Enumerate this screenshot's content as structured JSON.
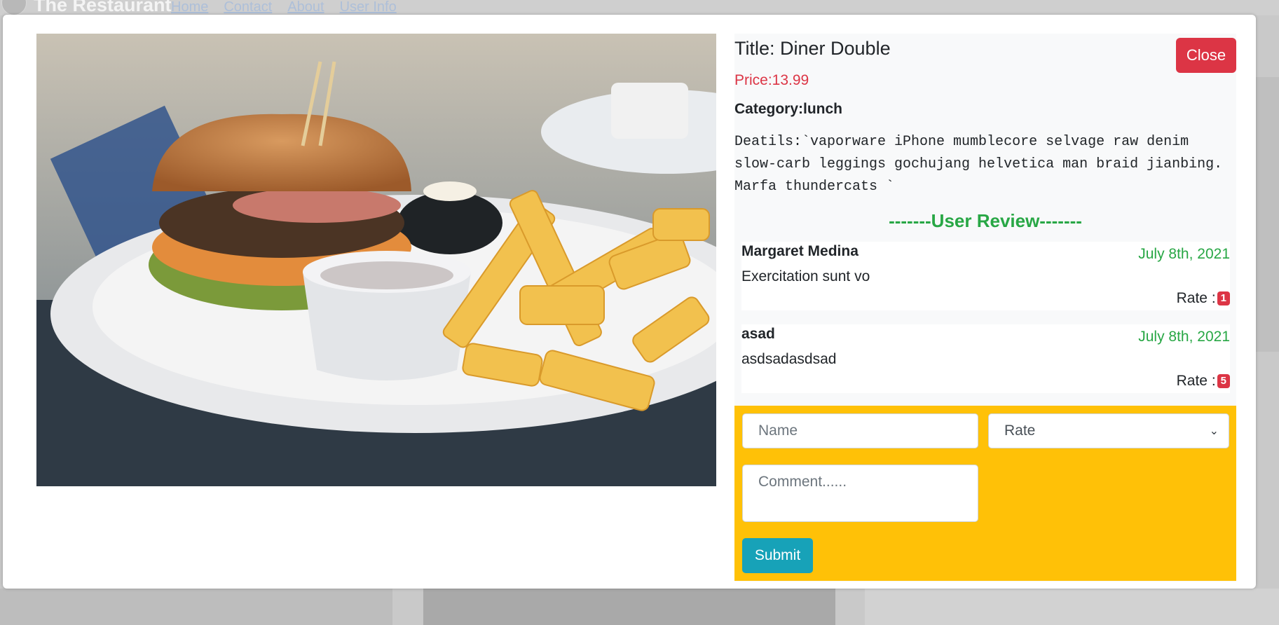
{
  "background": {
    "brand": "The Restaurant",
    "nav_links": [
      "Home",
      "Contact",
      "About",
      "User Info"
    ]
  },
  "modal": {
    "title": "Title: Diner Double",
    "close_label": "Close",
    "price": "Price:13.99",
    "category": "Category:lunch",
    "details": "Deatils:`vaporware iPhone mumblecore selvage raw denim slow-carb leggings gochujang helvetica man braid jianbing. Marfa thundercats `",
    "review_heading": "-------User Review-------",
    "reviews": [
      {
        "name": "Margaret Medina",
        "date": "July 8th, 2021",
        "comment": "Exercitation sunt vo",
        "rate_label": "Rate :",
        "rate": "1"
      },
      {
        "name": "asad",
        "date": "July 8th, 2021",
        "comment": "asdsadasdsad",
        "rate_label": "Rate :",
        "rate": "5"
      }
    ],
    "form": {
      "name_placeholder": "Name",
      "rate_selected": "Rate",
      "comment_placeholder": "Comment......",
      "submit_label": "Submit"
    }
  },
  "colors": {
    "close": "#dc3545",
    "price": "#dc3545",
    "review_heading": "#28a745",
    "form_bg": "#ffc107",
    "submit": "#17a2b8"
  },
  "icons": {
    "select_caret": "chevron-down-icon",
    "food_image": "burger-and-fries-photo"
  }
}
